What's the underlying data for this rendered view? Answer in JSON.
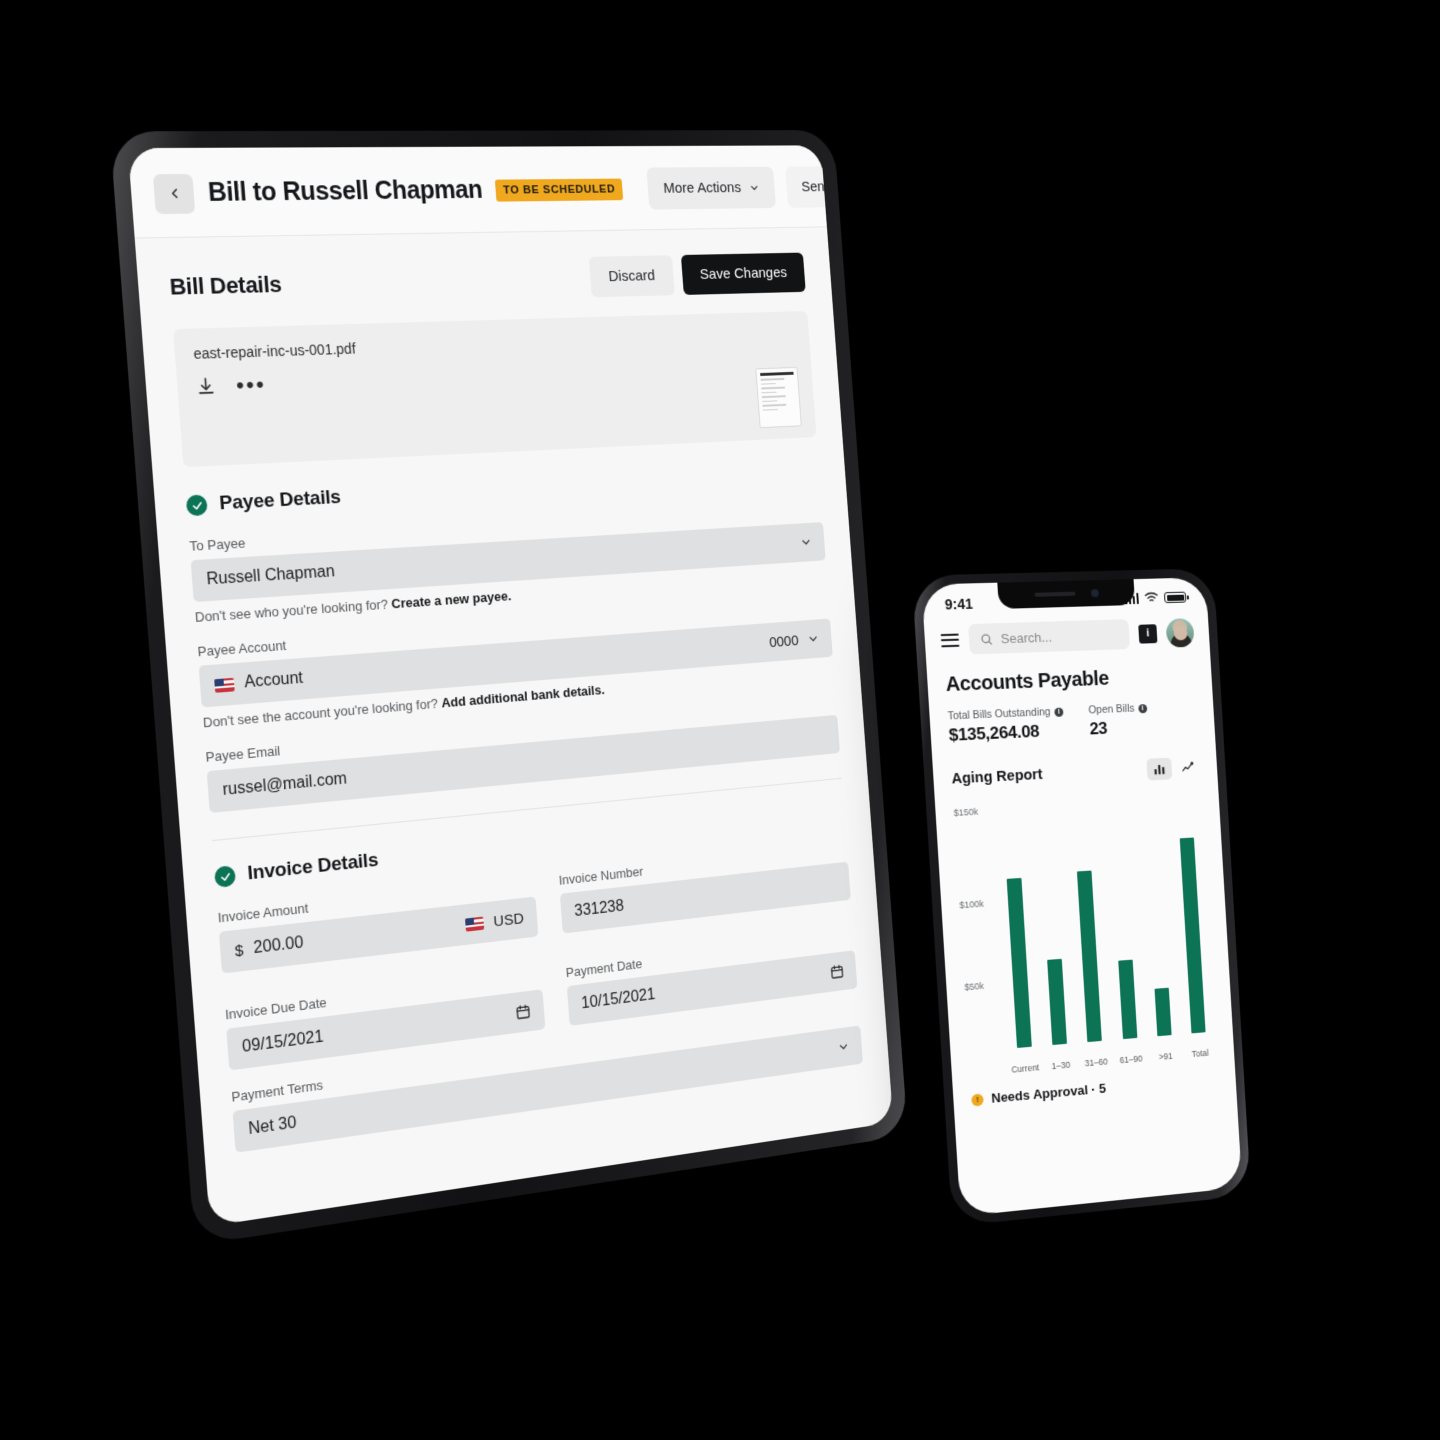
{
  "tablet": {
    "header": {
      "back_icon": "chevron-left-icon",
      "title": "Bill to Russell Chapman",
      "status_badge": "TO BE SCHEDULED",
      "more_actions_label": "More Actions",
      "send_for_approval_label": "Send for Approval"
    },
    "bill_details": {
      "section_title": "Bill Details",
      "discard_label": "Discard",
      "save_label": "Save Changes",
      "file_name": "east-repair-inc-us-001.pdf",
      "download_icon": "download-icon",
      "more_icon": "more-horizontal-icon"
    },
    "payee_details": {
      "section_title": "Payee Details",
      "to_payee_label": "To Payee",
      "to_payee_value": "Russell Chapman",
      "to_payee_helper_prefix": "Don't see who you're looking for? ",
      "to_payee_helper_link": "Create a new payee.",
      "payee_account_label": "Payee Account",
      "payee_account_value": "Account",
      "payee_account_number": "0000",
      "payee_account_helper_prefix": "Don't see the account you're looking for? ",
      "payee_account_helper_link": "Add additional bank details.",
      "payee_email_label": "Payee Email",
      "payee_email_value": "russel@mail.com"
    },
    "invoice_details": {
      "section_title": "Invoice Details",
      "invoice_amount_label": "Invoice Amount",
      "invoice_amount_currency_symbol": "$",
      "invoice_amount_value": "200.00",
      "invoice_amount_currency_code": "USD",
      "invoice_number_label": "Invoice Number",
      "invoice_number_value": "331238",
      "invoice_due_date_label": "Invoice Due Date",
      "invoice_due_date_value": "09/15/2021",
      "payment_date_label": "Payment Date",
      "payment_date_value": "10/15/2021",
      "payment_terms_label": "Payment Terms",
      "payment_terms_value": "Net 30"
    }
  },
  "phone": {
    "status_bar": {
      "time": "9:41",
      "signal_icon": "cellular-bars-icon",
      "wifi_icon": "wifi-icon",
      "battery_icon": "battery-icon"
    },
    "topbar": {
      "menu_icon": "hamburger-menu-icon",
      "search_icon": "search-icon",
      "search_placeholder": "Search...",
      "notification_icon": "notification-icon",
      "avatar_icon": "user-avatar"
    },
    "page_title": "Accounts Payable",
    "kpis": [
      {
        "label": "Total Bills Outstanding",
        "value": "$135,264.08",
        "info_icon": "info-icon"
      },
      {
        "label": "Open Bills",
        "value": "23",
        "info_icon": "info-icon"
      }
    ],
    "chart_header": {
      "title": "Aging Report",
      "bar_toggle_icon": "bar-chart-icon",
      "line_toggle_icon": "line-chart-icon",
      "active_toggle": "bar"
    },
    "footer": {
      "approval_label": "Needs Approval · 5",
      "approval_dot": "amber-status-dot"
    }
  },
  "chart_data": {
    "type": "bar",
    "title": "Aging Report",
    "categories": [
      "Current",
      "1–30",
      "31–60",
      "61–90",
      ">91",
      "Total"
    ],
    "values": [
      111000,
      56000,
      113000,
      52000,
      32000,
      131000
    ],
    "ytick_labels": [
      "$150k",
      "$100k",
      "$50k"
    ],
    "ytick_values": [
      150000,
      100000,
      50000
    ],
    "ylim": [
      0,
      160000
    ],
    "xlabel": "",
    "ylabel": "",
    "grid": false,
    "legend": false,
    "bar_color": "#0d7355"
  }
}
